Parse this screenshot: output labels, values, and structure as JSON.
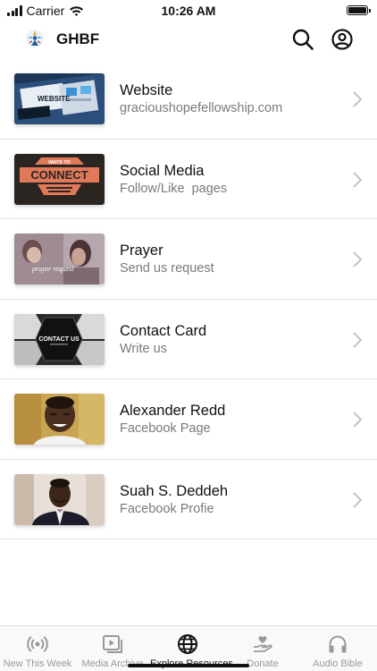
{
  "status_bar": {
    "carrier": "Carrier",
    "time": "10:26 AM"
  },
  "header": {
    "title": "GHBF",
    "search_icon": "search-icon",
    "profile_icon": "user-circle-icon"
  },
  "resources": [
    {
      "title": "Website",
      "subtitle": "gracioushopefellowship.com",
      "thumb_text": "WEBSITE"
    },
    {
      "title": "Social Media",
      "subtitle": "Follow/Like  pages",
      "thumb_text": "CONNECT",
      "thumb_caption": "WAYS TO"
    },
    {
      "title": "Prayer",
      "subtitle": "Send us request",
      "thumb_text": "prayer request"
    },
    {
      "title": "Contact Card",
      "subtitle": "Write us",
      "thumb_text": "CONTACT US"
    },
    {
      "title": "Alexander Redd",
      "subtitle": "Facebook Page"
    },
    {
      "title": "Suah S. Deddeh",
      "subtitle": "Facebook Profie"
    }
  ],
  "tabs": [
    {
      "label": "New This Week",
      "icon": "broadcast-icon",
      "active": false
    },
    {
      "label": "Media Archive",
      "icon": "play-library-icon",
      "active": false
    },
    {
      "label": "Explore Resources",
      "icon": "globe-icon",
      "active": true
    },
    {
      "label": "Donate",
      "icon": "donate-hand-icon",
      "active": false
    },
    {
      "label": "Audio Bible",
      "icon": "headphones-icon",
      "active": false
    }
  ],
  "colors": {
    "active_tab": "#111111",
    "inactive_tab": "#9a9a9a",
    "subtitle": "#7a7a7a",
    "connect_orange": "#e0795a"
  }
}
